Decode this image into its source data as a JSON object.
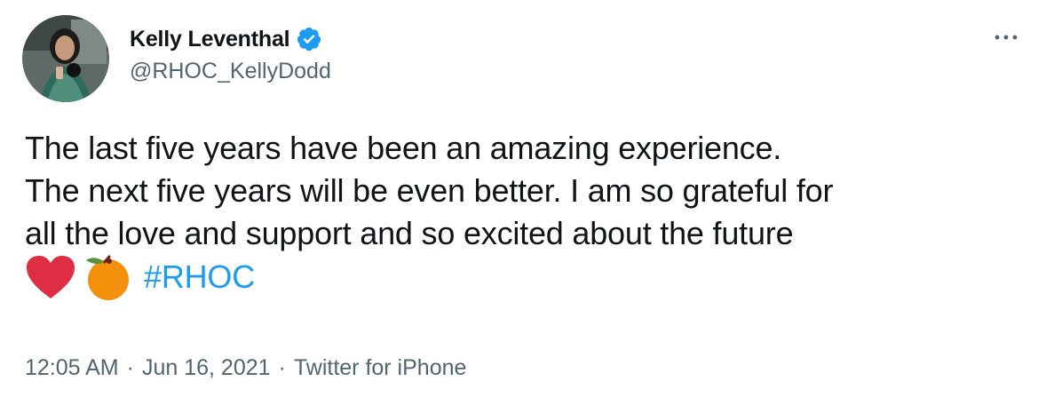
{
  "author": {
    "display_name": "Kelly Leventhal",
    "handle": "@RHOC_KellyDodd",
    "verified": true,
    "avatar_icon": "profile-photo",
    "verified_icon": "verified-badge-icon"
  },
  "tweet": {
    "lines": [
      "The last five years have been an amazing experience.",
      "The next five years will be even better. I am so grateful for",
      "all the love and support and so excited about the future"
    ],
    "emojis": [
      "heart-emoji",
      "tangerine-emoji"
    ],
    "hashtag": "#RHOC"
  },
  "meta": {
    "time": "12:05 AM",
    "separator": "·",
    "date": "Jun 16, 2021",
    "source": "Twitter for iPhone"
  },
  "menu": {
    "more_icon": "more-options-icon"
  },
  "colors": {
    "text": "#0f1419",
    "secondary": "#536471",
    "link": "#1d9bf0",
    "verified": "#1d9bf0"
  }
}
